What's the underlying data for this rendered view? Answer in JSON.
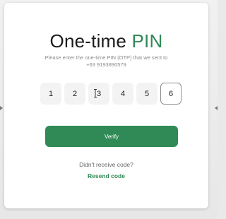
{
  "header": {
    "title_main": "One-time ",
    "title_accent": "PIN",
    "subtitle_line1": "Please enter the one-time PIN (OTP) that we sent to",
    "subtitle_line2": "+63 9193890579"
  },
  "otp": {
    "digits": [
      "1",
      "2",
      "3",
      "4",
      "5",
      "6"
    ],
    "active_index": 5
  },
  "actions": {
    "verify_label": "Verify",
    "no_code_text": "Didn't receive code?",
    "resend_label": "Resend code"
  },
  "colors": {
    "accent": "#2f8a55",
    "card": "#ffffff",
    "backdrop": "#e9e9e9"
  },
  "icons": {
    "text_cursor": "text-cursor-icon",
    "left_arrow": "arrow-left-icon",
    "right_arrow": "arrow-right-icon"
  }
}
